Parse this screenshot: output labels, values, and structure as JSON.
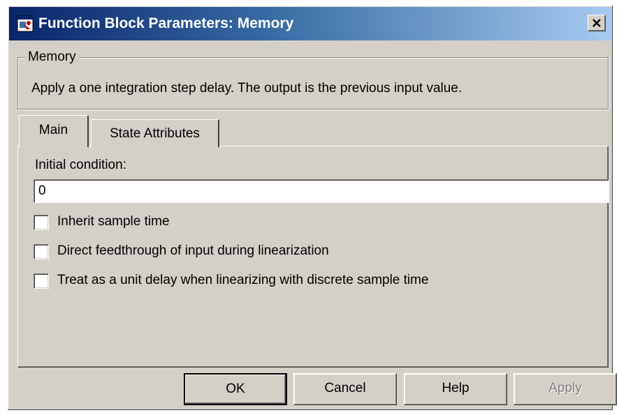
{
  "window": {
    "title": "Function Block Parameters: Memory",
    "close_label": "×",
    "icon": "simulink-block-icon"
  },
  "group": {
    "legend": "Memory",
    "description": "Apply a one integration step delay. The output is the previous input value."
  },
  "tabs": [
    {
      "label": "Main",
      "selected": true
    },
    {
      "label": "State Attributes",
      "selected": false
    }
  ],
  "main": {
    "initial_condition_label": "Initial condition:",
    "initial_condition_value": "0",
    "checkboxes": [
      {
        "label": "Inherit sample time",
        "checked": false
      },
      {
        "label": "Direct feedthrough of input during linearization",
        "checked": false
      },
      {
        "label": "Treat as a unit delay when linearizing with discrete sample time",
        "checked": false
      }
    ]
  },
  "buttons": {
    "ok": "OK",
    "cancel": "Cancel",
    "help": "Help",
    "apply": "Apply",
    "apply_enabled": false
  },
  "colors": {
    "title_gradient_start": "#0a246a",
    "title_gradient_end": "#a6caf0",
    "face": "#d4d0c8"
  }
}
